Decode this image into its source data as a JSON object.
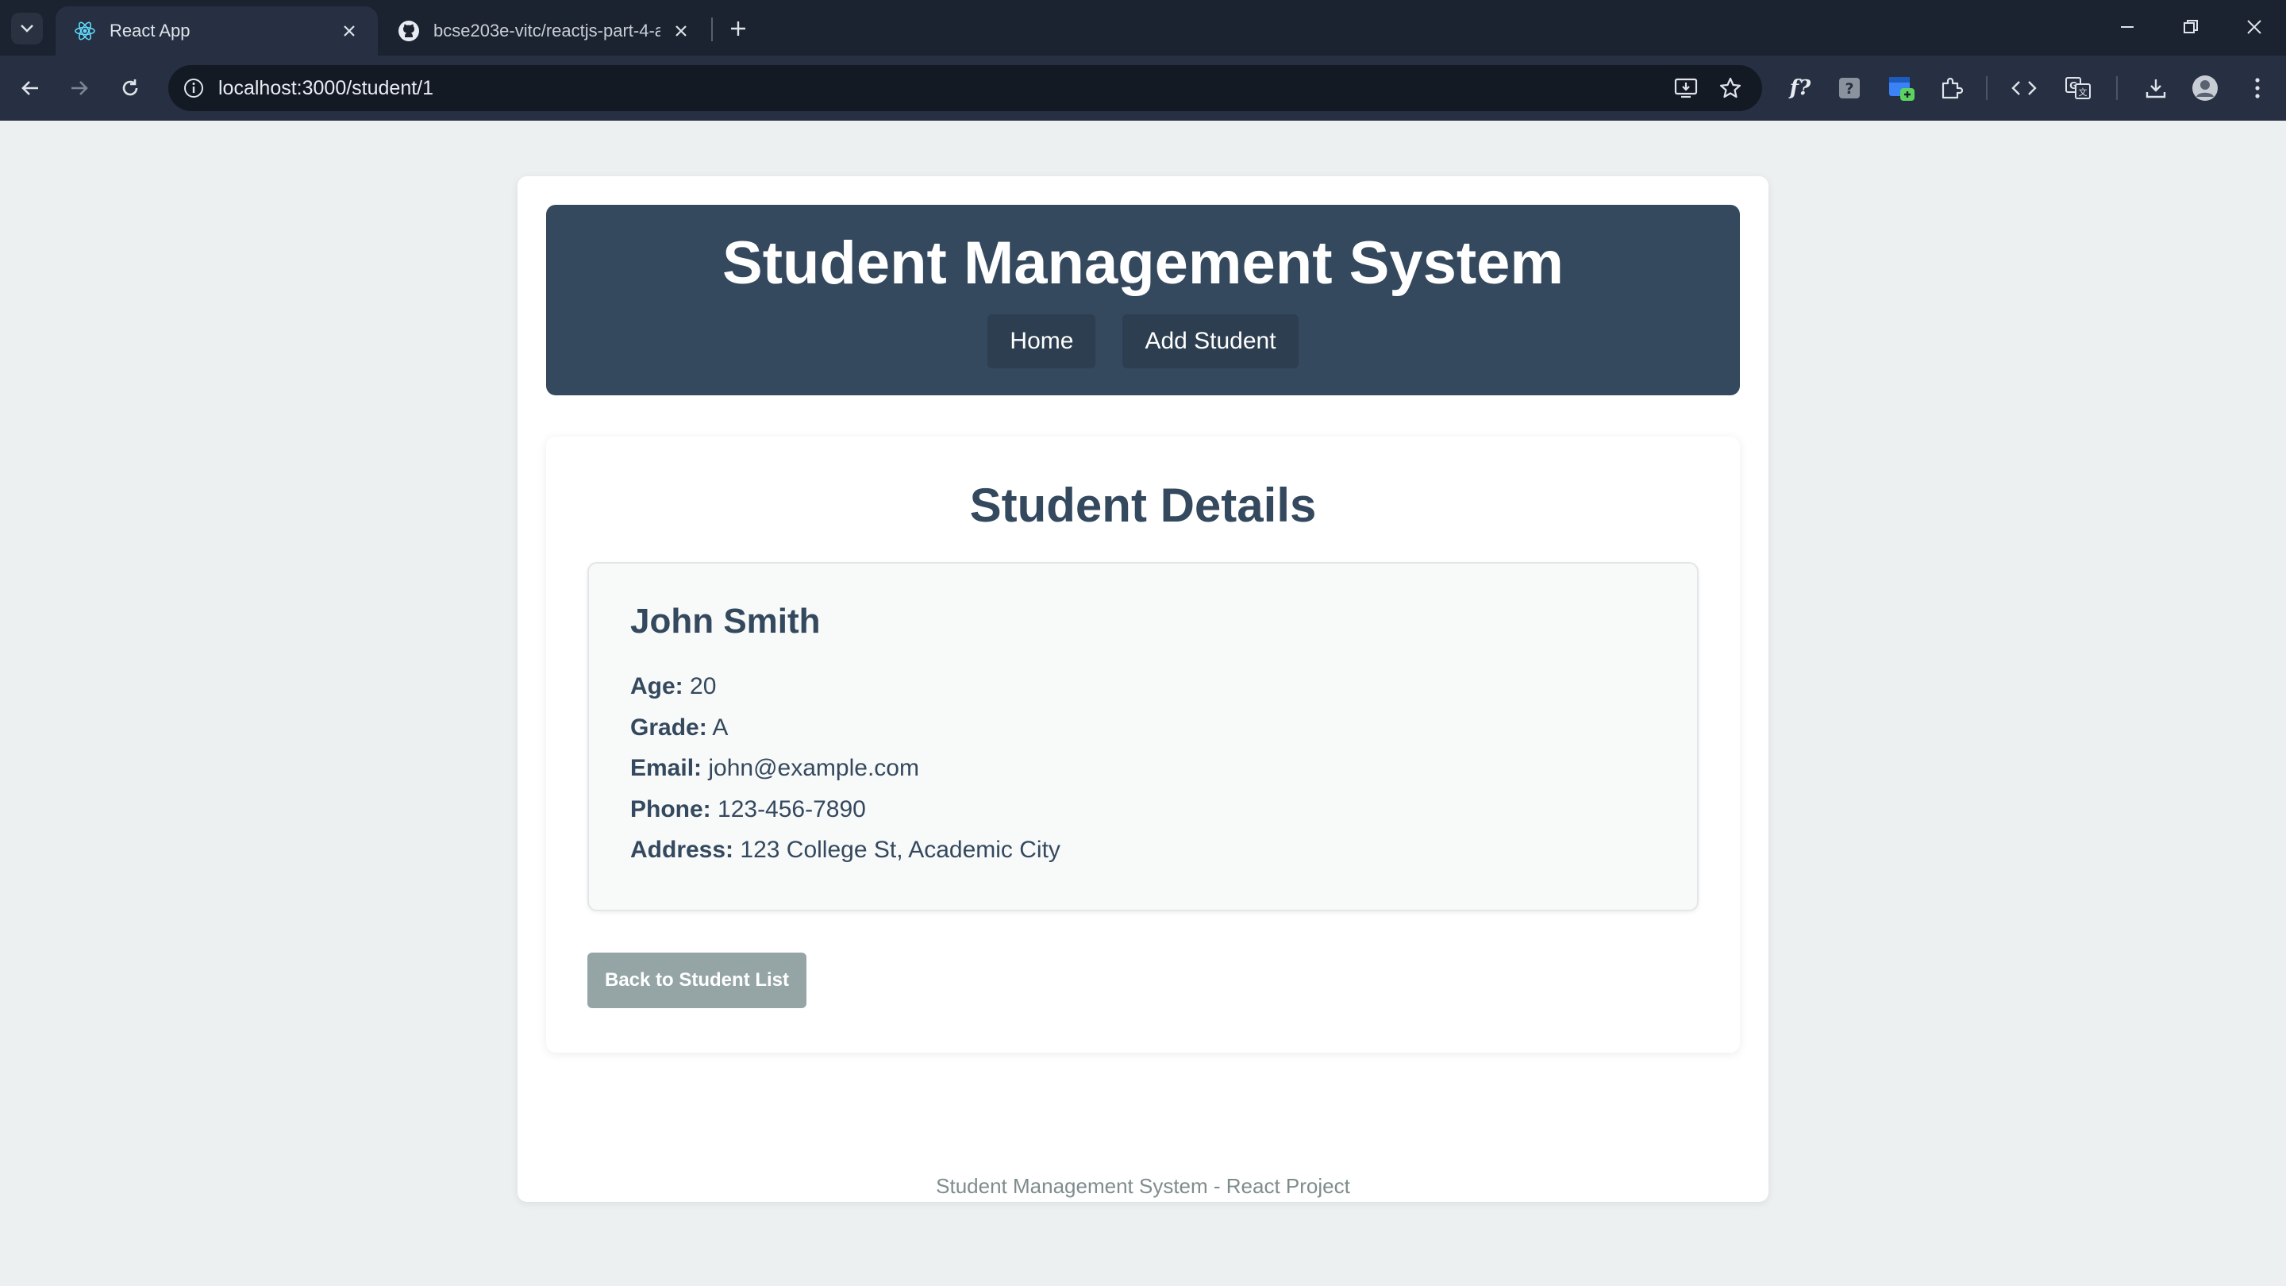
{
  "browser": {
    "tabs": [
      {
        "title": "React App",
        "icon": "react-icon",
        "active": true
      },
      {
        "title": "bcse203e-vitc/reactjs-part-4-a2",
        "icon": "github-icon",
        "active": false
      }
    ],
    "url": "localhost:3000/student/1"
  },
  "header": {
    "title": "Student Management System",
    "nav": {
      "home": "Home",
      "add_student": "Add Student"
    }
  },
  "details": {
    "heading": "Student Details",
    "student": {
      "name": "John Smith",
      "fields": [
        {
          "label": "Age:",
          "value": "20"
        },
        {
          "label": "Grade:",
          "value": "A"
        },
        {
          "label": "Email:",
          "value": "john@example.com"
        },
        {
          "label": "Phone:",
          "value": "123-456-7890"
        },
        {
          "label": "Address:",
          "value": "123 College St, Academic City"
        }
      ]
    },
    "back_button": "Back to Student List"
  },
  "footer": {
    "text": "Student Management System - React Project"
  },
  "colors": {
    "header_bg": "#34495e",
    "nav_btn_bg": "#2c3e50",
    "back_btn_bg": "#95a5a6",
    "page_bg": "#ecf0f1"
  }
}
